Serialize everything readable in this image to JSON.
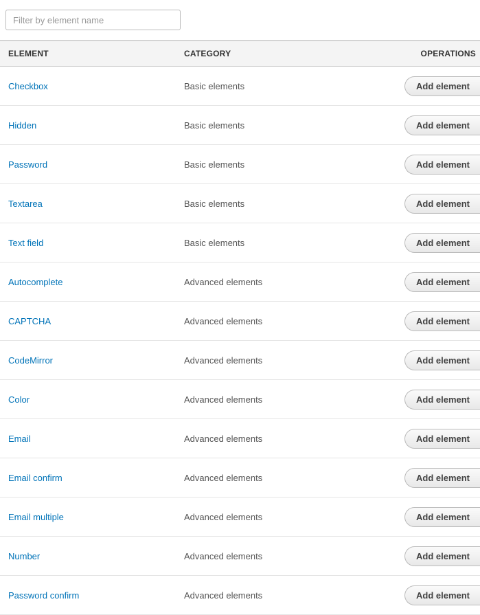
{
  "filter": {
    "placeholder": "Filter by element name"
  },
  "table": {
    "headers": {
      "element": "ELEMENT",
      "category": "CATEGORY",
      "operations": "OPERATIONS"
    },
    "rows": [
      {
        "element": "Checkbox",
        "category": "Basic elements",
        "action": "Add element"
      },
      {
        "element": "Hidden",
        "category": "Basic elements",
        "action": "Add element"
      },
      {
        "element": "Password",
        "category": "Basic elements",
        "action": "Add element"
      },
      {
        "element": "Textarea",
        "category": "Basic elements",
        "action": "Add element"
      },
      {
        "element": "Text field",
        "category": "Basic elements",
        "action": "Add element"
      },
      {
        "element": "Autocomplete",
        "category": "Advanced elements",
        "action": "Add element"
      },
      {
        "element": "CAPTCHA",
        "category": "Advanced elements",
        "action": "Add element"
      },
      {
        "element": "CodeMirror",
        "category": "Advanced elements",
        "action": "Add element"
      },
      {
        "element": "Color",
        "category": "Advanced elements",
        "action": "Add element"
      },
      {
        "element": "Email",
        "category": "Advanced elements",
        "action": "Add element"
      },
      {
        "element": "Email confirm",
        "category": "Advanced elements",
        "action": "Add element"
      },
      {
        "element": "Email multiple",
        "category": "Advanced elements",
        "action": "Add element"
      },
      {
        "element": "Number",
        "category": "Advanced elements",
        "action": "Add element"
      },
      {
        "element": "Password confirm",
        "category": "Advanced elements",
        "action": "Add element"
      }
    ]
  }
}
